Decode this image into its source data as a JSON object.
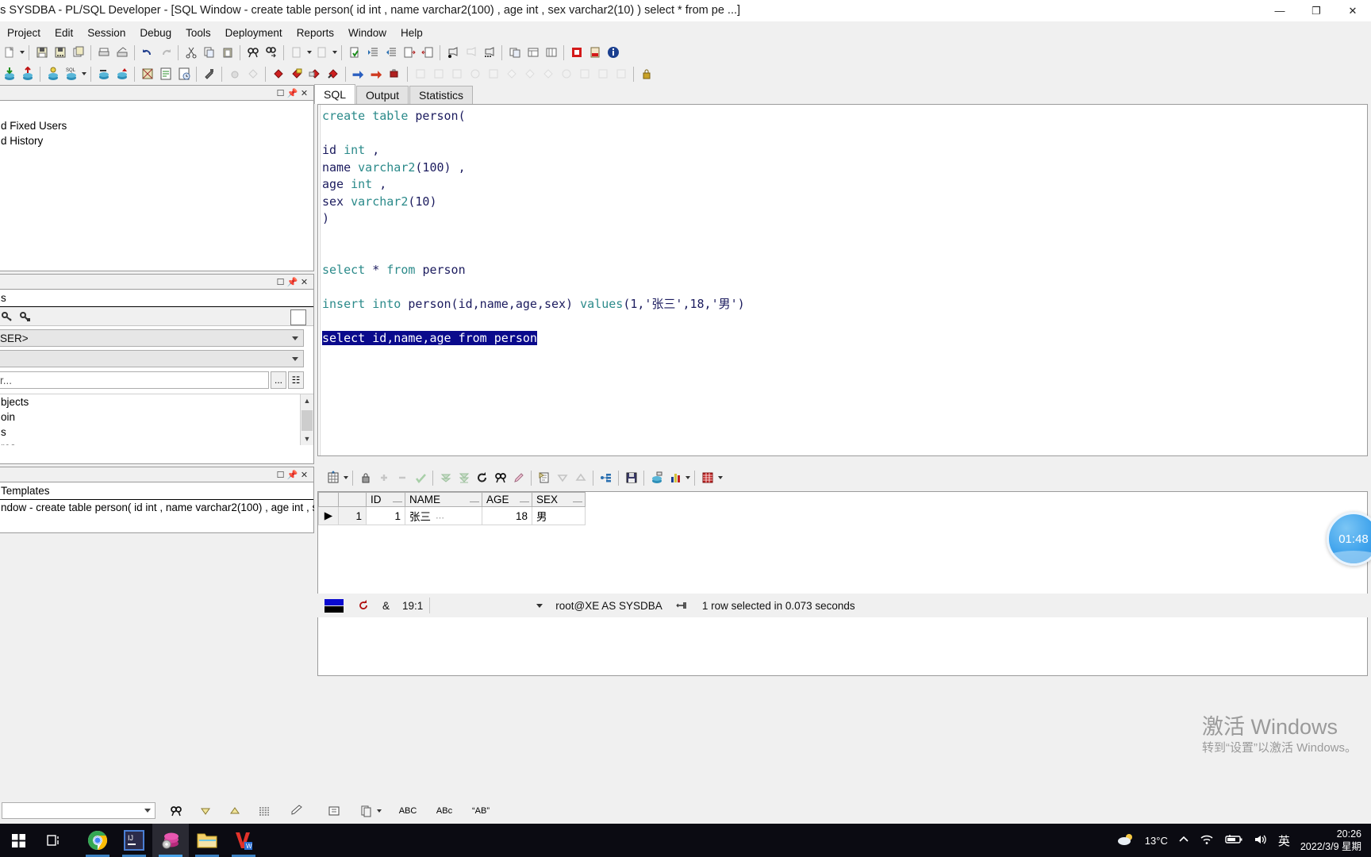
{
  "window": {
    "title": "as SYSDBA - PL/SQL Developer - [SQL Window - create table person( id int , name varchar2(100) , age int , sex varchar2(10) ) select * from pe ...]",
    "minimize": "—",
    "maximize": "❐",
    "close": "✕"
  },
  "menu": {
    "items": [
      {
        "label": "Project"
      },
      {
        "label": "Edit"
      },
      {
        "label": "Session"
      },
      {
        "label": "Debug"
      },
      {
        "label": "Tools"
      },
      {
        "label": "Deployment"
      },
      {
        "label": "Reports"
      },
      {
        "label": "Window"
      },
      {
        "label": "Help"
      }
    ]
  },
  "left_panels": {
    "logon_panel": {
      "rows": [
        "d Fixed Users",
        "d History"
      ]
    },
    "browser_panel": {
      "select_label": "s",
      "user_combo": "SER>",
      "second_combo": "",
      "filter_placeholder": "r...",
      "browse_button": "...",
      "doc_button": "☷",
      "objects": [
        "bjects",
        "oin",
        "s",
        "res"
      ]
    },
    "templates_panel": {
      "header": "Templates",
      "window_item": "ndow - create table person( id int , name varchar2(100) , age int , s"
    }
  },
  "main": {
    "tabs": [
      {
        "label": "SQL",
        "active": true
      },
      {
        "label": "Output",
        "active": false
      },
      {
        "label": "Statistics",
        "active": false
      }
    ],
    "editor": {
      "lines": [
        [
          {
            "t": "create table ",
            "c": "kw"
          },
          {
            "t": "person(",
            "c": "pl"
          }
        ],
        [],
        [
          {
            "t": "id ",
            "c": "pl"
          },
          {
            "t": "int",
            "c": "kw"
          },
          {
            "t": " ,",
            "c": "pl"
          }
        ],
        [
          {
            "t": "name ",
            "c": "pl"
          },
          {
            "t": "varchar2",
            "c": "kw"
          },
          {
            "t": "(100) ,",
            "c": "pl"
          }
        ],
        [
          {
            "t": "age ",
            "c": "pl"
          },
          {
            "t": "int",
            "c": "kw"
          },
          {
            "t": " ,",
            "c": "pl"
          }
        ],
        [
          {
            "t": "sex ",
            "c": "pl"
          },
          {
            "t": "varchar2",
            "c": "kw"
          },
          {
            "t": "(10)",
            "c": "pl"
          }
        ],
        [
          {
            "t": ")",
            "c": "pl"
          }
        ],
        [],
        [],
        [
          {
            "t": "select ",
            "c": "kw"
          },
          {
            "t": "* ",
            "c": "pl"
          },
          {
            "t": "from ",
            "c": "kw"
          },
          {
            "t": "person",
            "c": "pl"
          }
        ],
        [],
        [
          {
            "t": "insert into ",
            "c": "kw"
          },
          {
            "t": "person(id,name,age,sex) ",
            "c": "pl"
          },
          {
            "t": "values",
            "c": "kw"
          },
          {
            "t": "(1,'张三',18,'男')",
            "c": "pl"
          }
        ],
        [],
        [
          {
            "t": "select id,name,age from person",
            "c": "sel"
          }
        ]
      ]
    },
    "result_grid": {
      "columns": [
        "ID",
        "NAME",
        "AGE",
        "SEX"
      ],
      "rows": [
        {
          "num": "1",
          "ID": "1",
          "NAME": "张三",
          "AGE": "18",
          "SEX": "男"
        }
      ]
    },
    "status": {
      "position": "19:1",
      "connection": "root@XE AS SYSDBA",
      "message": "1 row selected in 0.073 seconds"
    }
  },
  "bottom_toolbar": {
    "combo_value": "",
    "labels": [
      "ABC",
      "ABс",
      "“AB”"
    ]
  },
  "watermark": {
    "line1": "激活 Windows",
    "line2": "转到“设置”以激活 Windows。"
  },
  "timer": {
    "value": "01:48"
  },
  "taskbar": {
    "items": [
      {
        "name": "task-view",
        "icon": "task-view-icon"
      },
      {
        "name": "chrome",
        "icon": "chrome-icon"
      },
      {
        "name": "intellij-idea",
        "icon": "intellij-icon"
      },
      {
        "name": "plsql-developer",
        "icon": "plsql-developer-icon"
      },
      {
        "name": "file-explorer",
        "icon": "folder-icon"
      },
      {
        "name": "wps-office",
        "icon": "wps-icon"
      }
    ],
    "tray": {
      "weather": "13°C",
      "ime": "英",
      "time": "20:26",
      "date": "2022/3/9 星期"
    }
  },
  "colors": {
    "keyword": "#2b8a8a",
    "plain": "#1b1b5e",
    "selection_bg": "#0a0a8c",
    "accent": "#3fa3ec"
  }
}
